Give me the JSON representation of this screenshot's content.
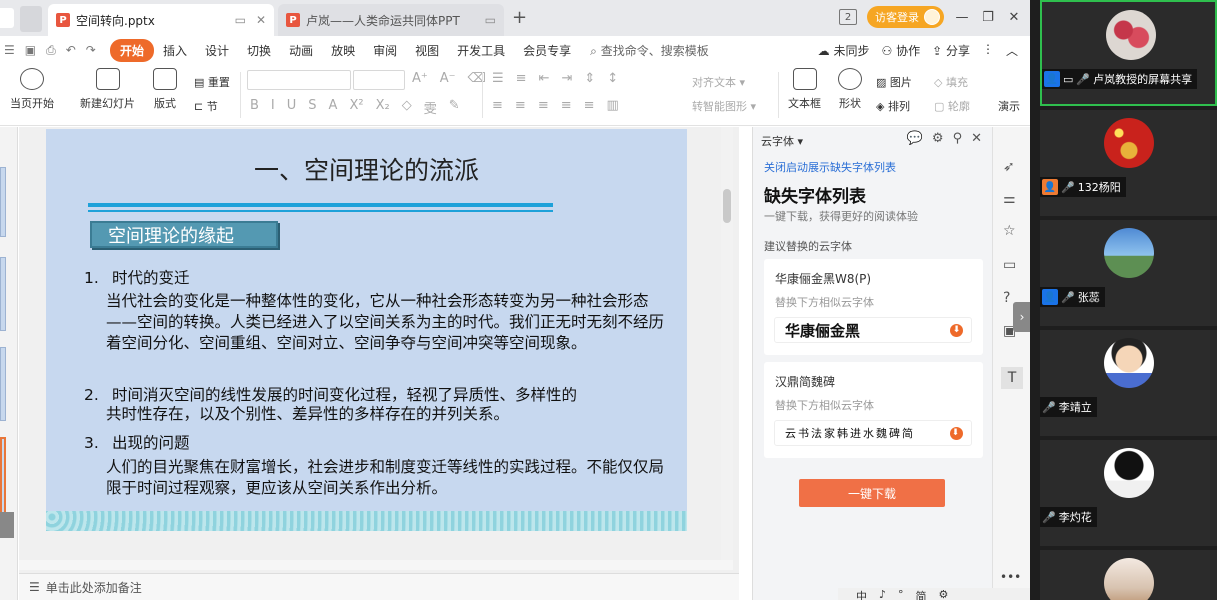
{
  "tabs": [
    {
      "title": "空间转向.pptx",
      "icon": "P"
    },
    {
      "title": "卢岚——人类命运共同体PPT",
      "icon": "P"
    }
  ],
  "titlebar": {
    "page_count": "2",
    "visitor_login": "访客登录"
  },
  "menu": {
    "items": [
      "开始",
      "插入",
      "设计",
      "切换",
      "动画",
      "放映",
      "审阅",
      "视图",
      "开发工具",
      "会员专享"
    ],
    "search": "查找命令、搜索模板",
    "right": [
      "未同步",
      "协作",
      "分享"
    ]
  },
  "ribbon": {
    "play_from_current": "当页开始",
    "new_slide": "新建幻灯片",
    "layout": "版式",
    "reset": "重置",
    "section": "节",
    "align_text": "对齐文本",
    "smart_shape": "转智能图形",
    "textbox": "文本框",
    "shape": "形状",
    "picture": "图片",
    "fill": "填充",
    "arrange": "排列",
    "outline": "轮廓",
    "presenter": "演示"
  },
  "slide": {
    "title": "一、空间理论的流派",
    "subheading": "空间理论的缘起",
    "sections": [
      {
        "num": "1.",
        "heading": "时代的变迁",
        "body": "当代社会的变化是一种整体性的变化，它从一种社会形态转变为另一种社会形态——空间的转换。人类已经进入了以空间关系为主的时代。我们正无时无刻不经历着空间分化、空间重组、空间对立、空间争夺与空间冲突等空间现象。"
      },
      {
        "num": "2.",
        "heading": "时间消灭空间的线性发展的时间变化过程，轻视了异质性、多样性的",
        "body": "共时性存在，以及个别性、差异性的多样存在的并列关系。"
      },
      {
        "num": "3.",
        "heading": "出现的问题",
        "body": "人们的目光聚焦在财富增长，社会进步和制度变迁等线性的实践过程。不能仅仅局限于时间过程观察，更应该从空间关系作出分析。"
      }
    ]
  },
  "notes_placeholder": "单击此处添加备注",
  "cloud_font": {
    "header": "云字体",
    "hide_link": "关闭启动展示缺失字体列表",
    "title": "缺失字体列表",
    "subtitle": "一键下载，获得更好的阅读体验",
    "suggest_label": "建议替换的云字体",
    "fonts": [
      {
        "name": "华康俪金黑W8(P)",
        "hint": "替换下方相似云字体",
        "sample": "华康俪金黑"
      },
      {
        "name": "汉鼎简魏碑",
        "hint": "替换下方相似云字体",
        "sample": "云书法家韩进水魏碑简"
      }
    ],
    "download_all": "一键下载"
  },
  "ime": [
    "中",
    "♪",
    "°",
    "简",
    "⚙"
  ],
  "participants": [
    {
      "name": "卢岚教授的屏幕共享",
      "badge": "blue",
      "active": true
    },
    {
      "name": "132杨阳",
      "badge": "orange",
      "active": false
    },
    {
      "name": "张蕊",
      "badge": "blue",
      "active": false
    },
    {
      "name": "李靖立",
      "badge": "none",
      "active": false
    },
    {
      "name": "李灼花",
      "badge": "none",
      "active": false
    },
    {
      "name": "",
      "badge": "none",
      "active": false
    }
  ],
  "colors": {
    "accent": "#ee6a2a",
    "slide_bg": "#c7d8ef",
    "title_rule": "#1ea1d9",
    "active_speaker": "#2fbf4e"
  }
}
